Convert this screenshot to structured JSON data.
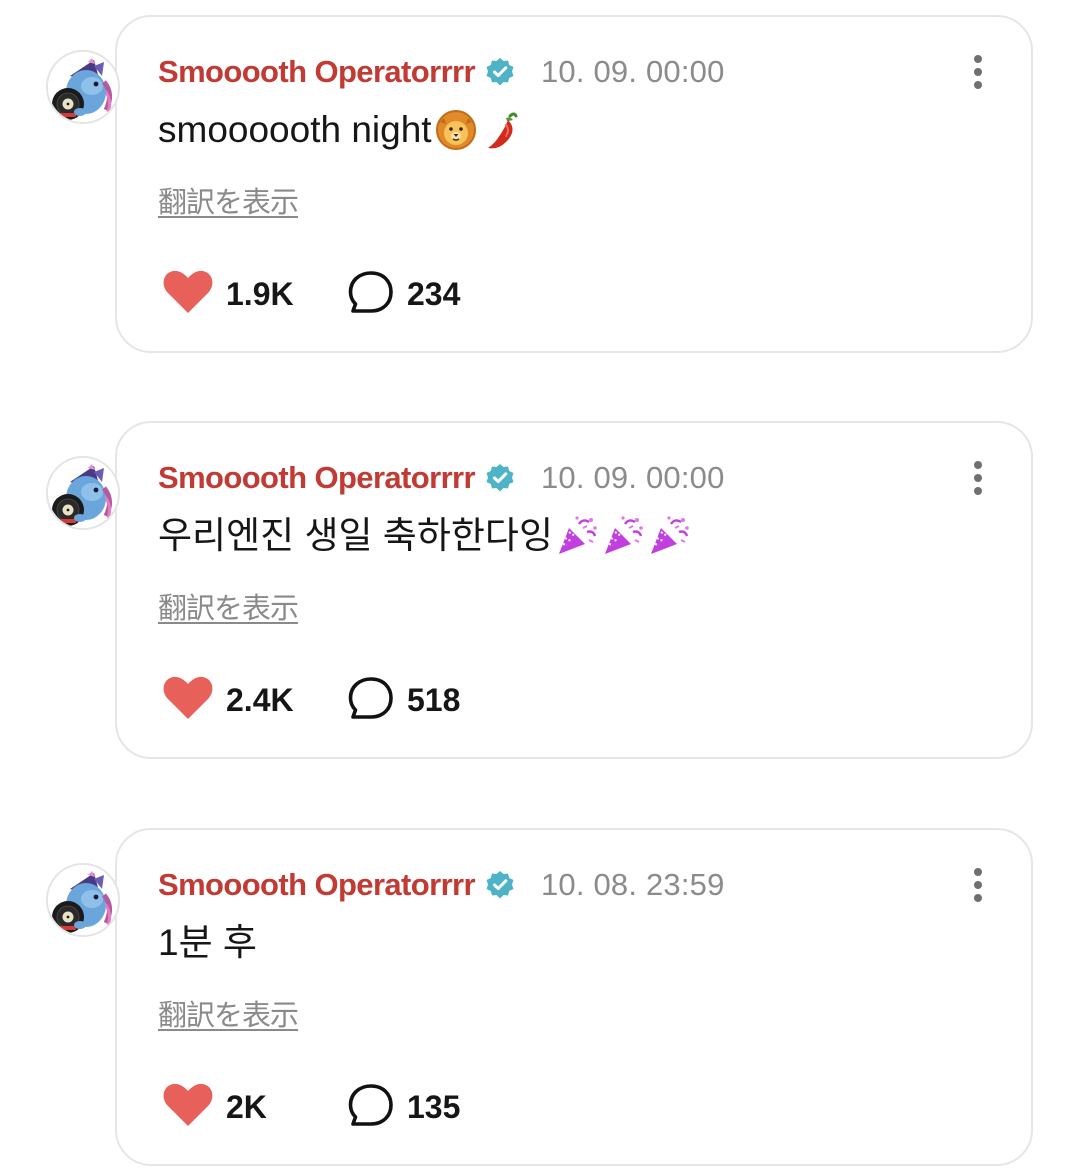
{
  "posts": [
    {
      "author": "Smooooth Operatorrrr",
      "timestamp": "10. 09. 00:00",
      "text": "smoooooth night",
      "emojis": [
        "lion-face",
        "hot-pepper"
      ],
      "translate_label": "翻訳を表示",
      "likes": "1.9K",
      "comments": "234"
    },
    {
      "author": "Smooooth Operatorrrr",
      "timestamp": "10. 09. 00:00",
      "text": "우리엔진 생일 축하한다잉",
      "emojis": [
        "party-popper",
        "party-popper",
        "party-popper"
      ],
      "translate_label": "翻訳を表示",
      "likes": "2.4K",
      "comments": "518"
    },
    {
      "author": "Smooooth Operatorrrr",
      "timestamp": "10. 08. 23:59",
      "text": "1분 후",
      "emojis": [],
      "translate_label": "翻訳を表示",
      "likes": "2K",
      "comments": "135"
    }
  ],
  "colors": {
    "author_name": "#c23a34",
    "verified_badge": "#4fb3c8",
    "heart": "#e8605a",
    "timestamp": "#8b8b8b",
    "card_border": "#e6e6e6",
    "translate_link": "#8a8a8a"
  }
}
